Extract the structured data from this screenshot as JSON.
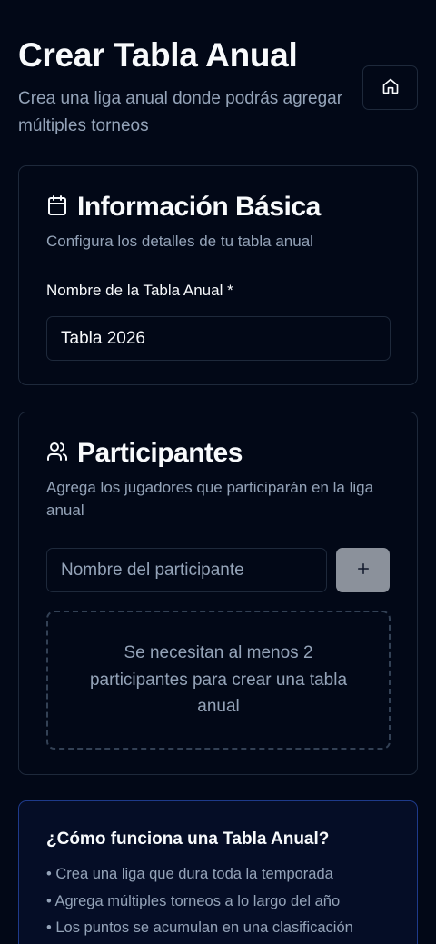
{
  "header": {
    "title": "Crear Tabla Anual",
    "subtitle": "Crea una liga anual donde podrás agregar múltiples torneos",
    "home_icon": "home-icon"
  },
  "basic_info": {
    "icon": "calendar-icon",
    "title": "Información Básica",
    "description": "Configura los detalles de tu tabla anual",
    "name_label": "Nombre de la Tabla Anual *",
    "name_value": "Tabla 2026"
  },
  "participants": {
    "icon": "users-icon",
    "title": "Participantes",
    "description": "Agrega los jugadores que participarán en la liga anual",
    "input_placeholder": "Nombre del participante",
    "input_value": "",
    "add_icon": "plus-icon",
    "empty_message": "Se necesitan al menos 2 participantes para crear una tabla anual"
  },
  "how_it_works": {
    "title": "¿Cómo funciona una Tabla Anual?",
    "items": [
      "• Crea una liga que dura toda la temporada",
      "• Agrega múltiples torneos a lo largo del año",
      "• Los puntos se acumulan en una clasificación"
    ]
  },
  "colors": {
    "background": "#020817",
    "border": "#1e293b",
    "muted_text": "#94a3b8",
    "add_button": "#8b919b",
    "info_border": "#1e3a8a"
  }
}
